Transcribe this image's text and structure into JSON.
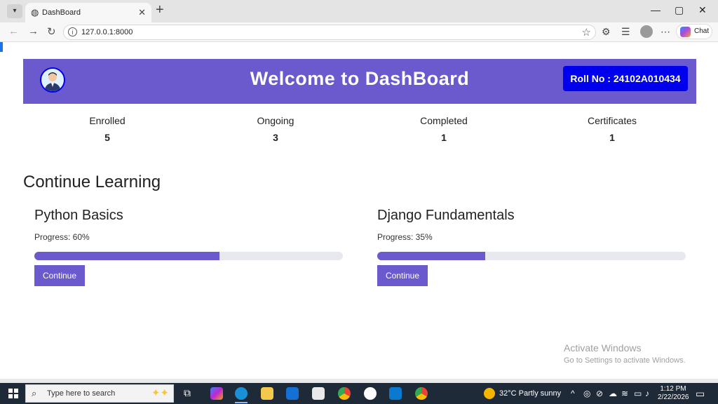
{
  "browser": {
    "tab_title": "DashBoard",
    "url": "127.0.0.1:8000",
    "chat_label": "Chat"
  },
  "header": {
    "title": "Welcome to DashBoard",
    "roll": "Roll No : 24102A010434"
  },
  "stats": [
    {
      "label": "Enrolled",
      "value": "5"
    },
    {
      "label": "Ongoing",
      "value": "3"
    },
    {
      "label": "Completed",
      "value": "1"
    },
    {
      "label": "Certificates",
      "value": "1"
    }
  ],
  "section_title": "Continue Learning",
  "courses": [
    {
      "name": "Python Basics",
      "progress_label": "Progress: 60%",
      "progress": 60,
      "button": "Continue"
    },
    {
      "name": "Django Fundamentals",
      "progress_label": "Progress: 35%",
      "progress": 35,
      "button": "Continue"
    }
  ],
  "watermark": {
    "title": "Activate Windows",
    "subtitle": "Go to Settings to activate Windows."
  },
  "taskbar": {
    "search_placeholder": "Type here to search",
    "weather": "32°C  Partly sunny",
    "time": "1:12 PM",
    "date": "2/22/2026"
  },
  "colors": {
    "accent": "#6a5acd",
    "roll_badge": "#0000ee"
  }
}
